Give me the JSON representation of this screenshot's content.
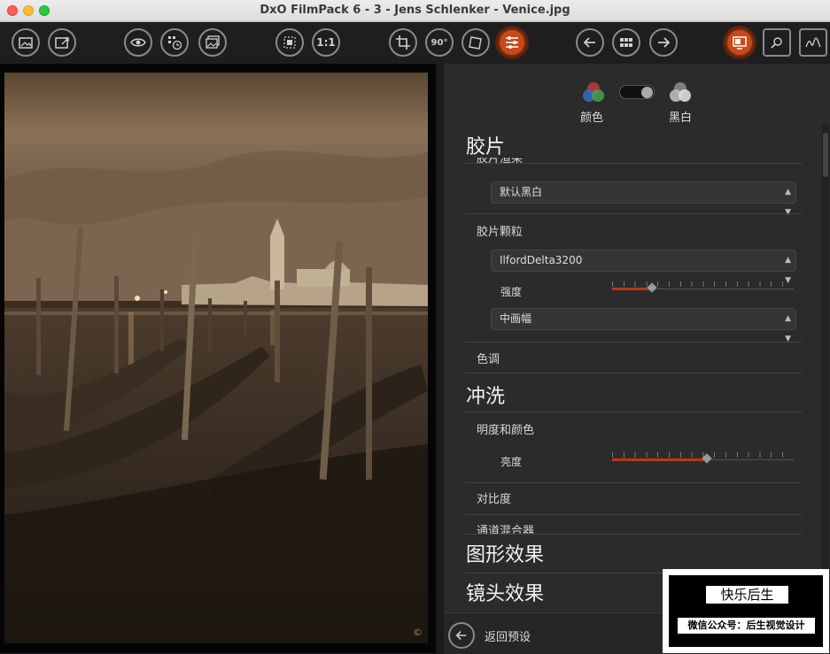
{
  "window": {
    "title": "DxO FilmPack 6 - 3 - Jens Schlenker - Venice.jpg"
  },
  "toolbar": {
    "zoom_label": "1:1",
    "rotate_label": "90°",
    "accent_color": "#c8491a"
  },
  "photo": {
    "copyright_mark": "©"
  },
  "panel": {
    "mode": {
      "color_label": "颜色",
      "bw_label": "黑白"
    },
    "sections": {
      "film": "胶片",
      "film_render_partial": "胶片渲染",
      "film_render_value": "默认黑白",
      "grain_label": "胶片颗粒",
      "grain_value": "IlfordDelta3200",
      "intensity_label": "强度",
      "grain_size_value": "中画幅",
      "tone_label": "色调",
      "develop": "冲洗",
      "brightness_color_label": "明度和颜色",
      "brightness_label": "亮度",
      "contrast_label": "对比度",
      "channel_mixer_label": "通道混合器",
      "graphic_effects": "图形效果",
      "lens_effects": "镜头效果"
    },
    "sliders": {
      "intensity_value": 0.22,
      "brightness_value": 0.52
    },
    "back_label": "返回预设"
  },
  "watermark": {
    "title": "快乐后生",
    "subtitle": "微信公众号：后生视觉设计"
  }
}
